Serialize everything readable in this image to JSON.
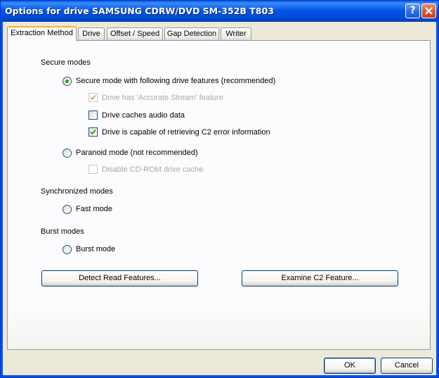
{
  "window": {
    "title": "Options for drive SAMSUNG CDRW/DVD SM-352B T803"
  },
  "tabs": [
    {
      "label": "Extraction Method",
      "active": true
    },
    {
      "label": "Drive",
      "active": false
    },
    {
      "label": "Offset / Speed",
      "active": false
    },
    {
      "label": "Gap Detection",
      "active": false
    },
    {
      "label": "Writer",
      "active": false
    }
  ],
  "secure_modes": {
    "title": "Secure modes",
    "secure_mode": {
      "label": "Secure mode with following drive features (recommended)",
      "selected": true
    },
    "accurate_stream": {
      "label": "Drive has 'Accurate Stream' feature",
      "checked": true,
      "enabled": false
    },
    "caches_audio": {
      "label": "Drive caches audio data",
      "checked": false,
      "enabled": true
    },
    "c2_error": {
      "label": "Drive is capable of retrieving C2 error information",
      "checked": true,
      "enabled": true
    },
    "paranoid_mode": {
      "label": "Paranoid mode (not recommended)",
      "selected": false
    },
    "disable_cache": {
      "label": "Disable CD-ROM drive cache",
      "checked": false,
      "enabled": false
    }
  },
  "sync_modes": {
    "title": "Synchronized modes",
    "fast_mode": {
      "label": "Fast mode",
      "selected": false
    }
  },
  "burst_modes": {
    "title": "Burst modes",
    "burst_mode": {
      "label": "Burst mode",
      "selected": false
    }
  },
  "buttons": {
    "detect": "Detect Read Features...",
    "examine": "Examine C2 Feature...",
    "ok": "OK",
    "cancel": "Cancel"
  },
  "icons": {
    "help": "help-icon",
    "close": "close-icon",
    "check": "checkmark-icon"
  },
  "colors": {
    "titlebar": "#0257e8",
    "radio_dot": "#21a121",
    "check": "#21a121",
    "tab_highlight": "#f7b21e"
  }
}
